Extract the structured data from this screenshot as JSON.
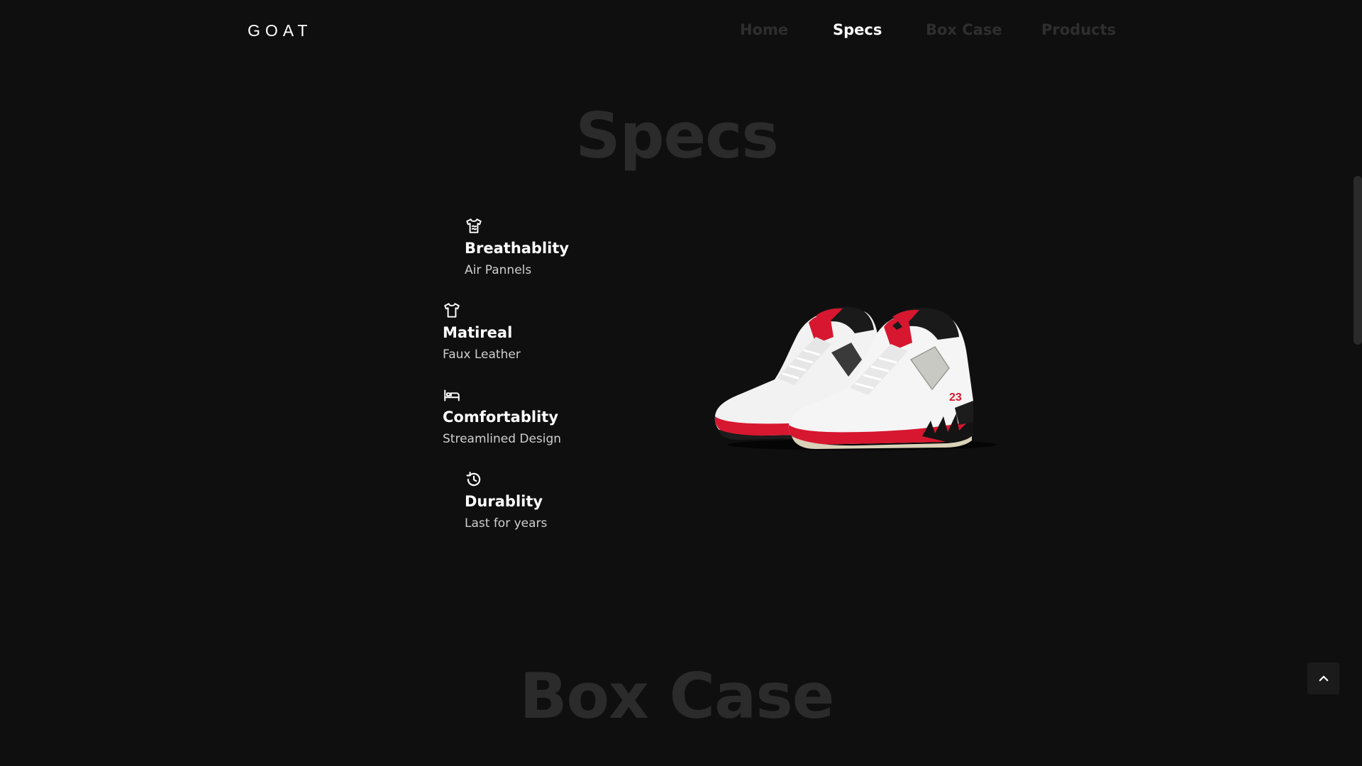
{
  "header": {
    "brand": "GOAT",
    "nav": [
      {
        "label": "Home",
        "active": false
      },
      {
        "label": "Specs",
        "active": true
      },
      {
        "label": "Box Case",
        "active": false
      },
      {
        "label": "Products",
        "active": false
      }
    ]
  },
  "specs": {
    "title": "Specs",
    "features": [
      {
        "icon": "shirt-care-icon",
        "title": "Breathablity",
        "subtitle": "Air Pannels"
      },
      {
        "icon": "tshirt-icon",
        "title": "Matireal",
        "subtitle": "Faux Leather"
      },
      {
        "icon": "bed-icon",
        "title": "Comfortablity",
        "subtitle": "Streamlined Design"
      },
      {
        "icon": "history-icon",
        "title": "Durablity",
        "subtitle": "Last for years"
      }
    ],
    "product_image": "sneaker-pair-image"
  },
  "box_case": {
    "title": "Box Case"
  },
  "controls": {
    "back_to_top_icon": "chevron-up-icon"
  },
  "colors": {
    "background": "#0f0f0f",
    "accent_red": "#d7172f",
    "text_primary": "#ffffff",
    "text_muted": "#2e2e2e"
  }
}
